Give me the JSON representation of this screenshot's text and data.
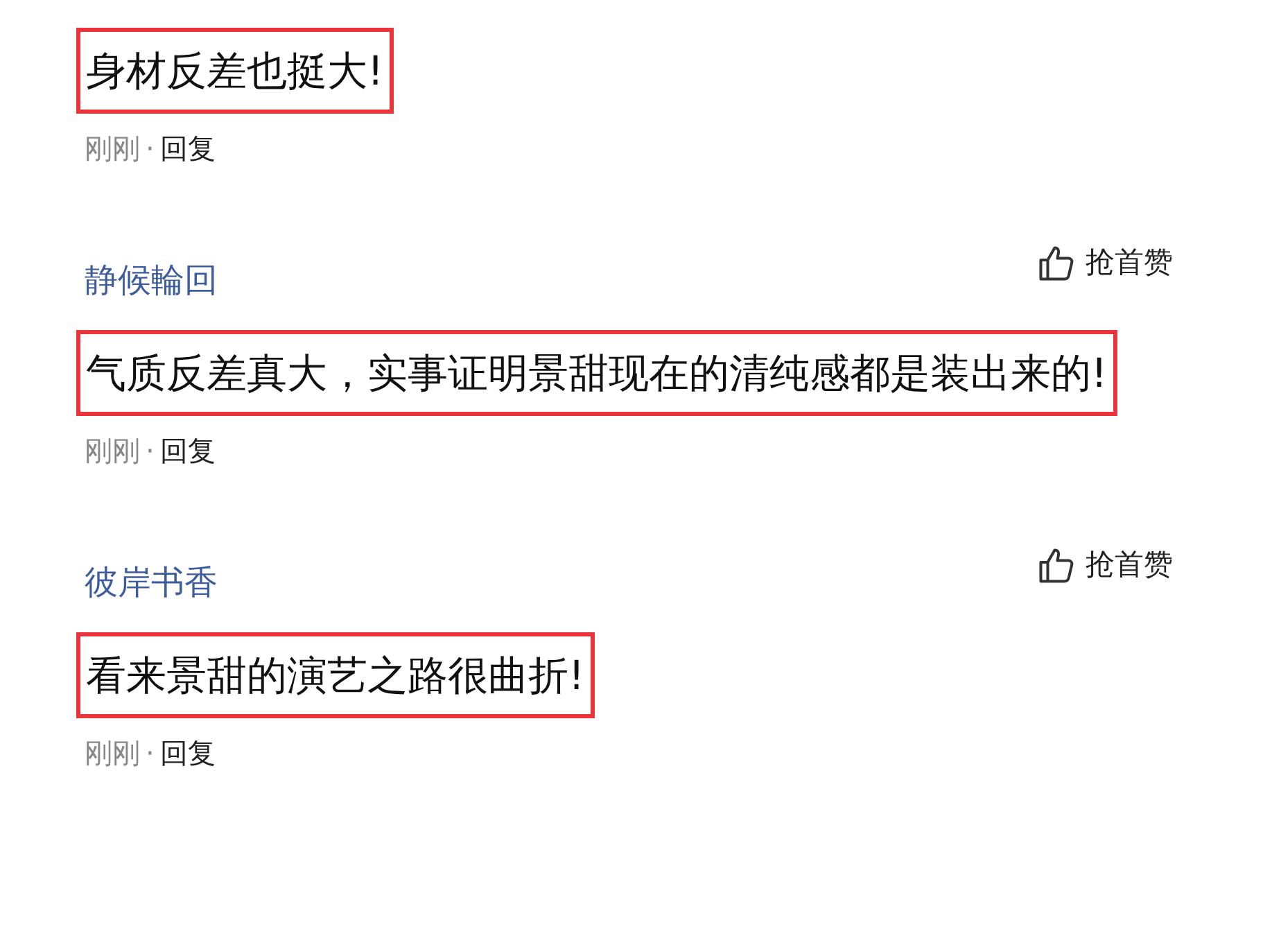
{
  "comments": [
    {
      "text": "身材反差也挺大!",
      "highlighted": true,
      "time": "刚刚",
      "separator": "·",
      "reply": "回复"
    },
    {
      "user": "静候輪回",
      "like": "抢首赞",
      "text": "气质反差真大，实事证明景甜现在的清纯感都是装出来的!",
      "highlighted": true,
      "time": "刚刚",
      "separator": "·",
      "reply": "回复"
    },
    {
      "user": "彼岸书香",
      "like": "抢首赞",
      "text": "看来景甜的演艺之路很曲折!",
      "highlighted": true,
      "time": "刚刚",
      "separator": "·",
      "reply": "回复"
    }
  ]
}
